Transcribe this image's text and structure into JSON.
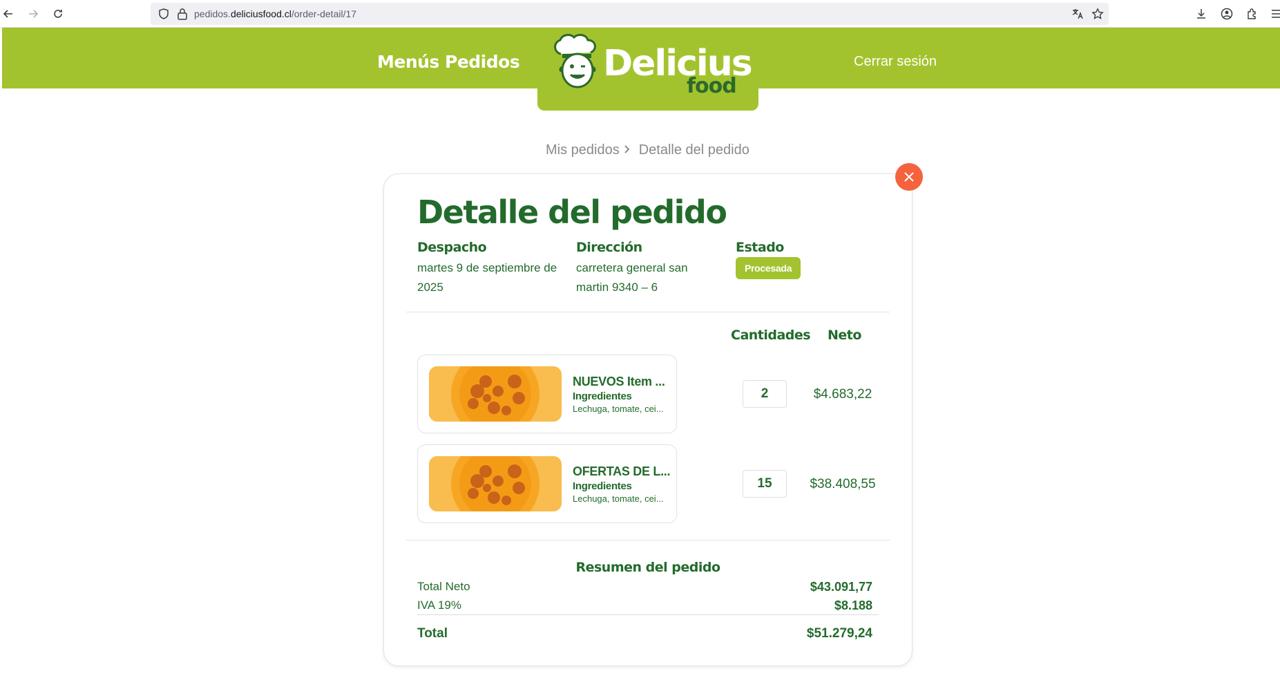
{
  "browser": {
    "url_prefix": "pedidos.",
    "url_domain": "deliciusfood.cl",
    "url_path": "/order-detail/17"
  },
  "header": {
    "nav_menus": "Menús",
    "nav_pedidos": "Pedidos",
    "logo_word": "Delicius",
    "logo_food": "food",
    "logout": "Cerrar sesión"
  },
  "breadcrumb": {
    "parent": "Mis pedidos",
    "current": "Detalle del pedido"
  },
  "order": {
    "title": "Detalle del pedido",
    "despacho_label": "Despacho",
    "despacho_value": "martes 9 de septiembre de 2025",
    "direccion_label": "Dirección",
    "direccion_value": "carretera general san martin 9340 – 6",
    "estado_label": "Estado",
    "estado_value": "Procesada"
  },
  "table": {
    "col_cantidades": "Cantidades",
    "col_neto": "Neto",
    "items": [
      {
        "name": "NUEVOS Item ...",
        "ingredients_label": "Ingredientes",
        "ingredients": "Lechuga, tomate, cei...",
        "quantity": "2",
        "net": "$4.683,22"
      },
      {
        "name": "OFERTAS DE L...",
        "ingredients_label": "Ingredientes",
        "ingredients": "Lechuga, tomate, cei...",
        "quantity": "15",
        "net": "$38.408,55"
      }
    ]
  },
  "summary": {
    "title": "Resumen del pedido",
    "total_neto_label": "Total Neto",
    "total_neto_value": "$43.091,77",
    "iva_label": "IVA 19%",
    "iva_value": "$8.188",
    "total_label": "Total",
    "total_value": "$51.279,24"
  },
  "colors": {
    "brand_green": "#a3c32e",
    "text_green": "#236b2c",
    "close_orange": "#f4633d"
  }
}
